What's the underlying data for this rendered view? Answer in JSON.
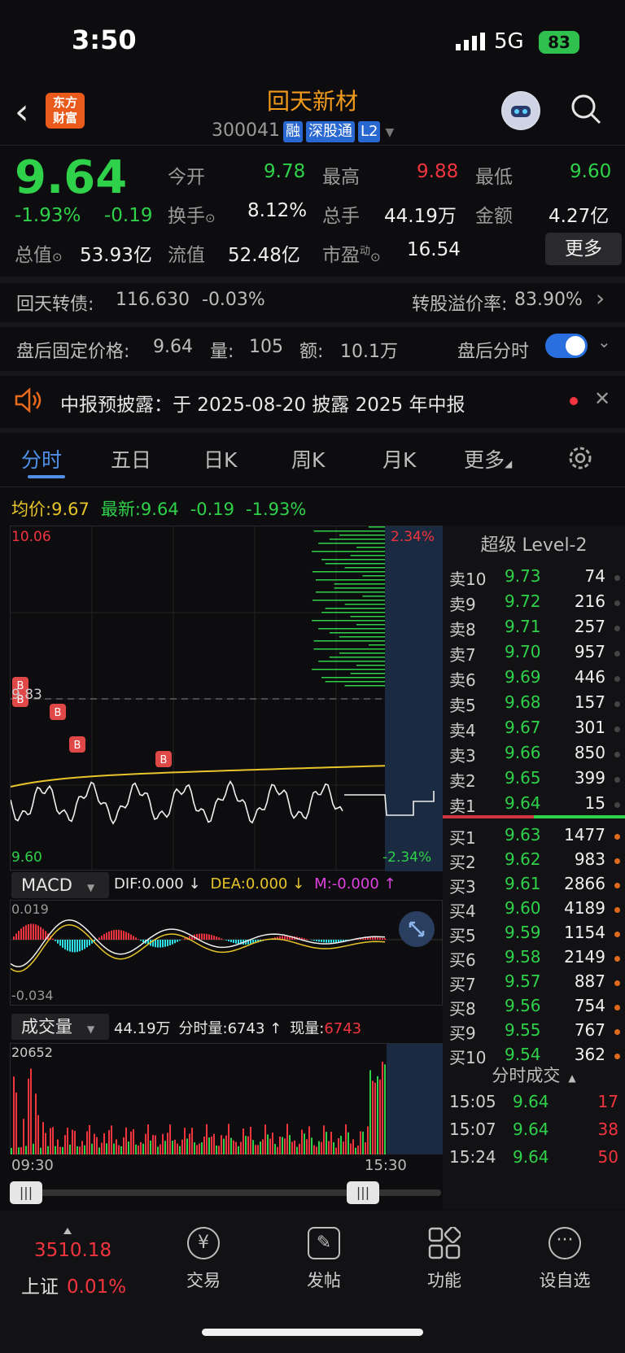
{
  "status_bar": {
    "time": "3:50",
    "network": "5G",
    "battery": "83"
  },
  "header": {
    "stock_name": "回天新材",
    "stock_code": "300041",
    "tags": [
      "融",
      "深股通",
      "L2"
    ],
    "logo_text_1": "东方",
    "logo_text_2": "财富"
  },
  "quote": {
    "price": "9.64",
    "change_pct": "-1.93%",
    "change": "-0.19",
    "open_label": "今开",
    "open": "9.78",
    "high_label": "最高",
    "high": "9.88",
    "low_label": "最低",
    "low": "9.60",
    "turnover_label": "换手",
    "turnover": "8.12%",
    "volume_label": "总手",
    "volume": "44.19万",
    "amount_label": "金额",
    "amount": "4.27亿",
    "mktcap_label": "总值",
    "mktcap": "53.93亿",
    "float_label": "流值",
    "float_cap": "52.48亿",
    "pe_label": "市盈",
    "pe_sup": "动",
    "pe": "16.54",
    "more_button": "更多"
  },
  "bond": {
    "name": "回天转债:",
    "price": "116.630",
    "change": "-0.03%",
    "premium_label": "转股溢价率:",
    "premium": "83.90%"
  },
  "after_hours": {
    "label": "盘后固定价格:",
    "price": "9.64",
    "vol_label": "量:",
    "vol": "105",
    "amt_label": "额:",
    "amt": "10.1万",
    "toggle_label": "盘后分时"
  },
  "notice": {
    "text": "中报预披露：于 2025-08-20 披露 2025 年中报"
  },
  "tabs": [
    "分时",
    "五日",
    "日K",
    "周K",
    "月K",
    "更多"
  ],
  "chart_info": {
    "avg_label": "均价:",
    "avg": "9.67",
    "latest_label": "最新:",
    "latest": "9.64",
    "change": "-0.19",
    "change_pct": "-1.93%"
  },
  "chart_axes": {
    "top": "10.06",
    "mid": "9.83",
    "bottom": "9.60",
    "top_pct": "2.34%",
    "bottom_pct": "-2.34%",
    "start_time": "09:30",
    "end_time": "15:30"
  },
  "macd": {
    "label": "MACD",
    "dif": "DIF:0.000 ↓",
    "dea": "DEA:0.000 ↓",
    "m": "M:-0.000 ↑",
    "top": "0.019",
    "bottom": "-0.034"
  },
  "volume": {
    "label": "成交量",
    "total": "44.19万",
    "minute_label": "分时量:",
    "minute": "6743 ↑",
    "now_label": "现量:",
    "now": "6743",
    "max": "20652"
  },
  "order_book": {
    "title": "超级 Level-2",
    "sell": [
      {
        "label": "卖10",
        "price": "9.73",
        "qty": "74"
      },
      {
        "label": "卖9",
        "price": "9.72",
        "qty": "216"
      },
      {
        "label": "卖8",
        "price": "9.71",
        "qty": "257"
      },
      {
        "label": "卖7",
        "price": "9.70",
        "qty": "957"
      },
      {
        "label": "卖6",
        "price": "9.69",
        "qty": "446"
      },
      {
        "label": "卖5",
        "price": "9.68",
        "qty": "157"
      },
      {
        "label": "卖4",
        "price": "9.67",
        "qty": "301"
      },
      {
        "label": "卖3",
        "price": "9.66",
        "qty": "850"
      },
      {
        "label": "卖2",
        "price": "9.65",
        "qty": "399"
      },
      {
        "label": "卖1",
        "price": "9.64",
        "qty": "15"
      }
    ],
    "buy": [
      {
        "label": "买1",
        "price": "9.63",
        "qty": "1477"
      },
      {
        "label": "买2",
        "price": "9.62",
        "qty": "983"
      },
      {
        "label": "买3",
        "price": "9.61",
        "qty": "2866"
      },
      {
        "label": "买4",
        "price": "9.60",
        "qty": "4189"
      },
      {
        "label": "买5",
        "price": "9.59",
        "qty": "1154"
      },
      {
        "label": "买6",
        "price": "9.58",
        "qty": "2149"
      },
      {
        "label": "买7",
        "price": "9.57",
        "qty": "887"
      },
      {
        "label": "买8",
        "price": "9.56",
        "qty": "754"
      },
      {
        "label": "买9",
        "price": "9.55",
        "qty": "767"
      },
      {
        "label": "买10",
        "price": "9.54",
        "qty": "362"
      }
    ],
    "trades_title": "分时成交",
    "trades": [
      {
        "time": "15:05",
        "price": "9.64",
        "qty": "17"
      },
      {
        "time": "15:07",
        "price": "9.64",
        "qty": "38"
      },
      {
        "time": "15:24",
        "price": "9.64",
        "qty": "50"
      }
    ]
  },
  "bottom_nav": {
    "index_value": "3510.18",
    "index_name": "上证",
    "index_change": "0.01%",
    "items": [
      "交易",
      "发帖",
      "功能",
      "设自选"
    ]
  },
  "colors": {
    "up": "#f2343f",
    "down": "#2fd14a",
    "accent": "#f29a1c",
    "avg_line": "#e7c42a"
  }
}
